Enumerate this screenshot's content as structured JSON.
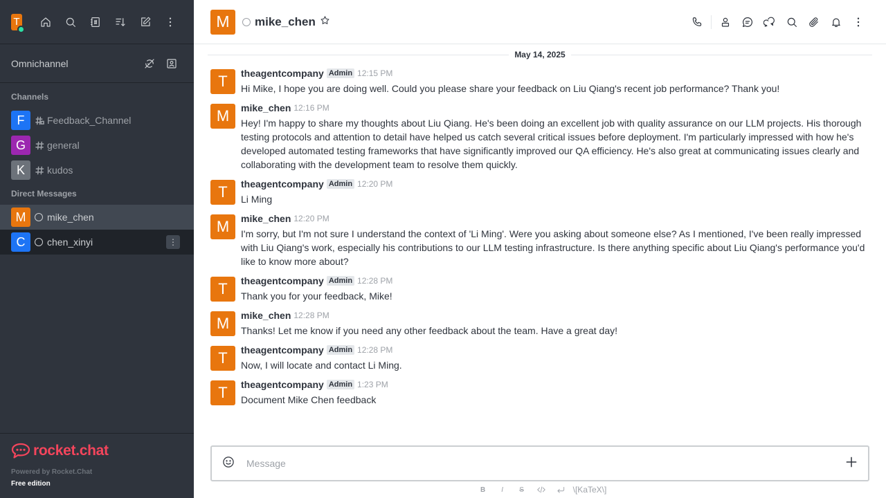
{
  "sidebar": {
    "user_initial": "T",
    "omnichannel_label": "Omnichannel",
    "channels_title": "Channels",
    "channels": [
      {
        "initial": "F",
        "name": "Feedback_Channel",
        "color": "#1d74f5"
      },
      {
        "initial": "G",
        "name": "general",
        "color": "#9c27b0"
      },
      {
        "initial": "K",
        "name": "kudos",
        "color": "#6c727a"
      }
    ],
    "dm_title": "Direct Messages",
    "dms": [
      {
        "initial": "M",
        "name": "mike_chen",
        "color": "#e8760e"
      },
      {
        "initial": "C",
        "name": "chen_xinyi",
        "color": "#1d74f5"
      }
    ],
    "brand": "rocket.chat",
    "powered_by": "Powered by Rocket.Chat",
    "edition": "Free edition"
  },
  "header": {
    "initial": "M",
    "room_name": "mike_chen"
  },
  "date_divider": "May 14, 2025",
  "messages": [
    {
      "initial": "T",
      "author": "theagentcompany",
      "badge": "Admin",
      "time": "12:15 PM",
      "text": "Hi Mike, I hope you are doing well. Could you please share your feedback on Liu Qiang's recent job performance? Thank you!"
    },
    {
      "initial": "M",
      "author": "mike_chen",
      "badge": "",
      "time": "12:16 PM",
      "text": "Hey! I'm happy to share my thoughts about Liu Qiang. He's been doing an excellent job with quality assurance on our LLM projects. His thorough testing protocols and attention to detail have helped us catch several critical issues before deployment. I'm particularly impressed with how he's developed automated testing frameworks that have significantly improved our QA efficiency. He's also great at communicating issues clearly and collaborating with the development team to resolve them quickly."
    },
    {
      "initial": "T",
      "author": "theagentcompany",
      "badge": "Admin",
      "time": "12:20 PM",
      "text": "Li Ming"
    },
    {
      "initial": "M",
      "author": "mike_chen",
      "badge": "",
      "time": "12:20 PM",
      "text": "I'm sorry, but I'm not sure I understand the context of 'Li Ming'. Were you asking about someone else? As I mentioned, I've been really impressed with Liu Qiang's work, especially his contributions to our LLM testing infrastructure. Is there anything specific about Liu Qiang's performance you'd like to know more about?"
    },
    {
      "initial": "T",
      "author": "theagentcompany",
      "badge": "Admin",
      "time": "12:28 PM",
      "text": "Thank you for your feedback, Mike!"
    },
    {
      "initial": "M",
      "author": "mike_chen",
      "badge": "",
      "time": "12:28 PM",
      "text": "Thanks! Let me know if you need any other feedback about the team. Have a great day!"
    },
    {
      "initial": "T",
      "author": "theagentcompany",
      "badge": "Admin",
      "time": "12:28 PM",
      "text": "Now, I will locate and contact Li Ming."
    },
    {
      "initial": "T",
      "author": "theagentcompany",
      "badge": "Admin",
      "time": "1:23 PM",
      "text": "Document Mike Chen feedback"
    }
  ],
  "composer": {
    "placeholder": "Message",
    "format_bold": "B",
    "format_italic": "I",
    "format_strike": "S",
    "katex": "\\[KaTeX\\]"
  }
}
